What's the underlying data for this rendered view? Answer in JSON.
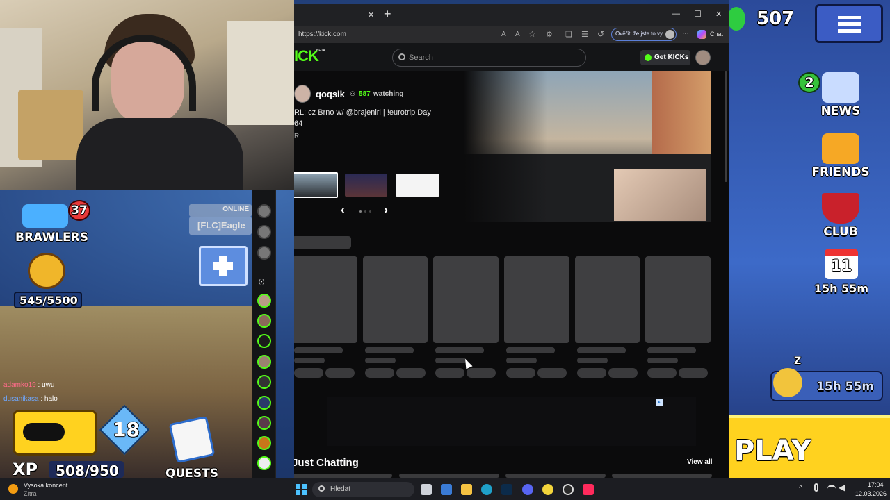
{
  "game": {
    "trophies": "507",
    "news": {
      "badge": "2",
      "label": "NEWS"
    },
    "friends": {
      "label": "FRIENDS"
    },
    "club": {
      "label": "CLUB"
    },
    "event": {
      "day": "11",
      "timer": "15h 55m"
    },
    "sleep_timer": "15h 55m",
    "sleep_z": "Z",
    "play_label": "PLAY",
    "brawlers": {
      "badge": "37",
      "label": "BRAWLERS"
    },
    "trophy_progress": "545/5500",
    "friend_online_label": "ONLINE",
    "friend_name": "[FLC]Eagle",
    "pass_level": "18",
    "xp_label": "XP",
    "xp_progress": "508/950",
    "quests_label": "QUESTS",
    "chat": [
      {
        "user": "adamko19",
        "msg": " : uwu",
        "color": "#ff6b8a"
      },
      {
        "user": "dusanikasa",
        "msg": " : halo",
        "color": "#6fa8ff"
      }
    ]
  },
  "browser": {
    "new_tab_icon": "+",
    "close_tab_icon": "✕",
    "window_controls": [
      "—",
      "☐",
      "✕"
    ],
    "url": "https://kick.com",
    "verify_label": "Ověřit, že jste to vy",
    "chat_label": "Chat",
    "more_icon": "···"
  },
  "kick": {
    "logo": "ICK",
    "logo_beta": "BETA",
    "search_placeholder": "Search",
    "get_kicks": "Get KICKs",
    "streamer": "qoqsik",
    "watching_count": "587",
    "watching_label": "watching",
    "stream_title_line1": "RL: cz Brno w/ @brajenirl | !eurotrip Day",
    "stream_title_line2": "64",
    "category": "RL",
    "carousel_prev": "‹",
    "carousel_next": "›",
    "section_title": "Just Chatting",
    "view_all": "View all",
    "ad_marker": "▸",
    "live_icon": "(•)"
  },
  "taskbar": {
    "weather_title": "Vysoká koncent...",
    "weather_sub": "Zítra",
    "search_placeholder": "Hledat",
    "time": "17:04",
    "date": "12.03.2026"
  },
  "colors": {
    "kick_green": "#53fc18",
    "yellow": "#ffd21f",
    "browser_bg": "#0b0b0c"
  }
}
